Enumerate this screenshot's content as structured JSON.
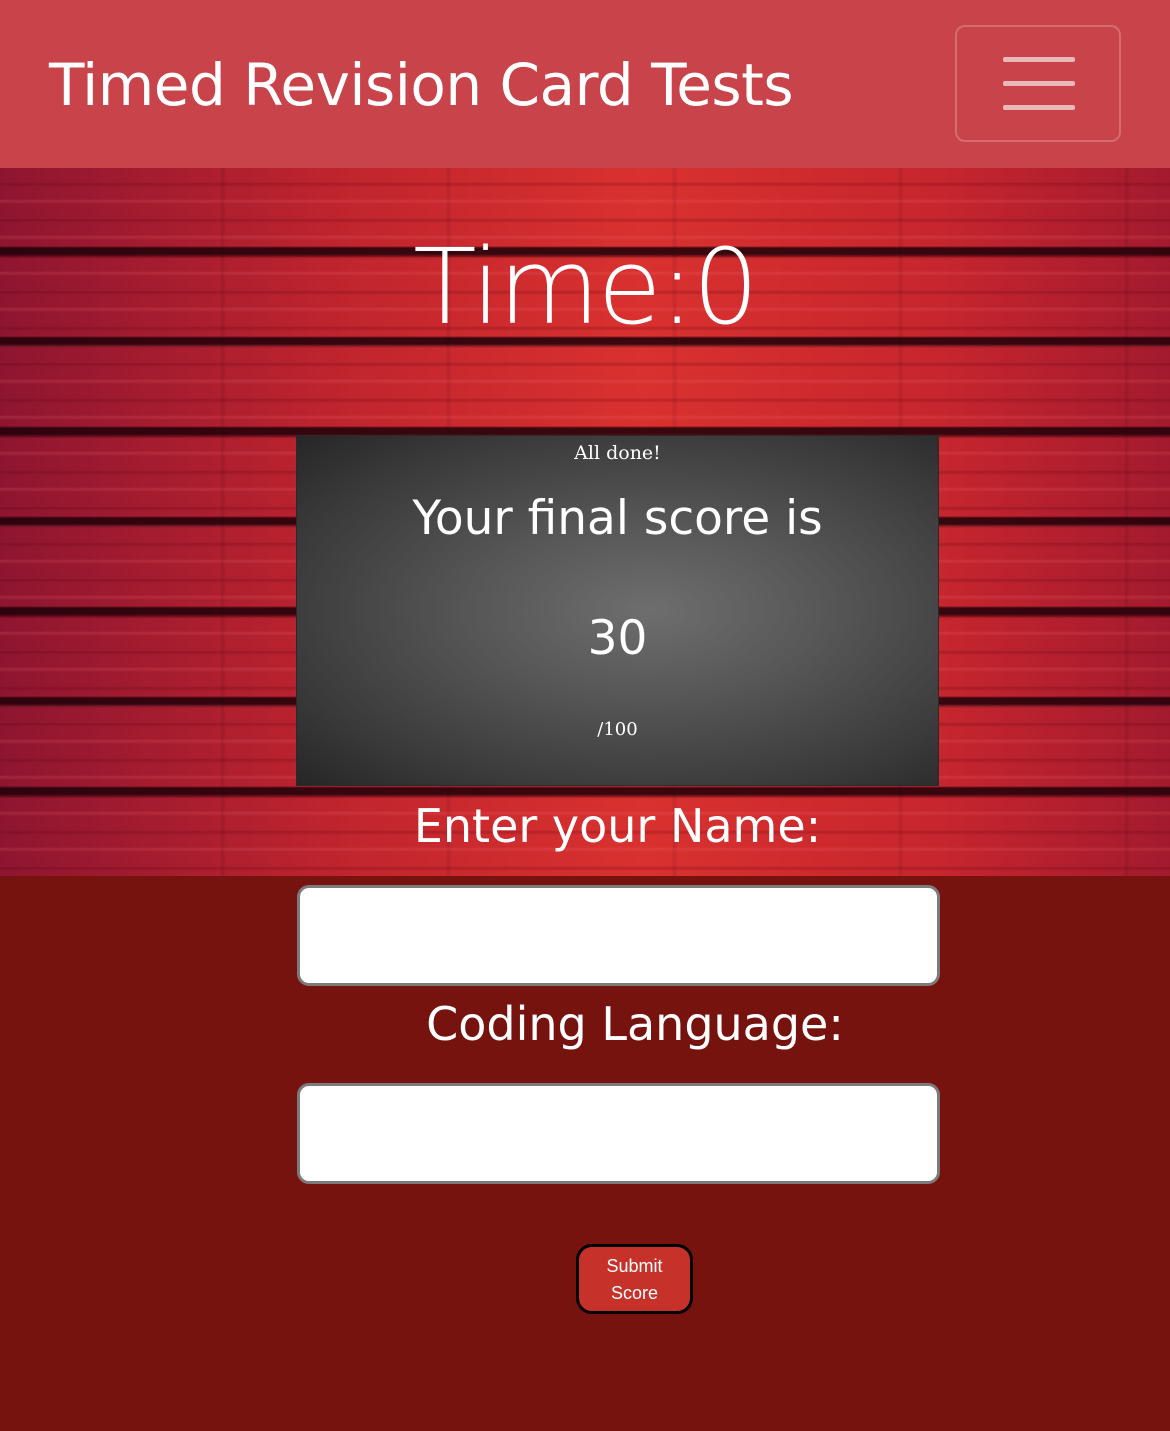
{
  "navbar": {
    "brand": "Timed Revision Card Tests",
    "toggler_icon": "hamburger-menu-icon"
  },
  "timer": {
    "text": "Time:0"
  },
  "result_card": {
    "status": "All done!",
    "score_label": "Your final score is",
    "score_value": "30",
    "score_max": "/100"
  },
  "form": {
    "name_label": "Enter your Name:",
    "name_value": "",
    "language_label": "Coding Language:",
    "language_value": "",
    "submit_label": "Submit Score"
  },
  "colors": {
    "navbar": "#c9434a",
    "page_background": "#77130f",
    "wood_accent": "#c1252e",
    "submit_button": "#c6312a"
  }
}
